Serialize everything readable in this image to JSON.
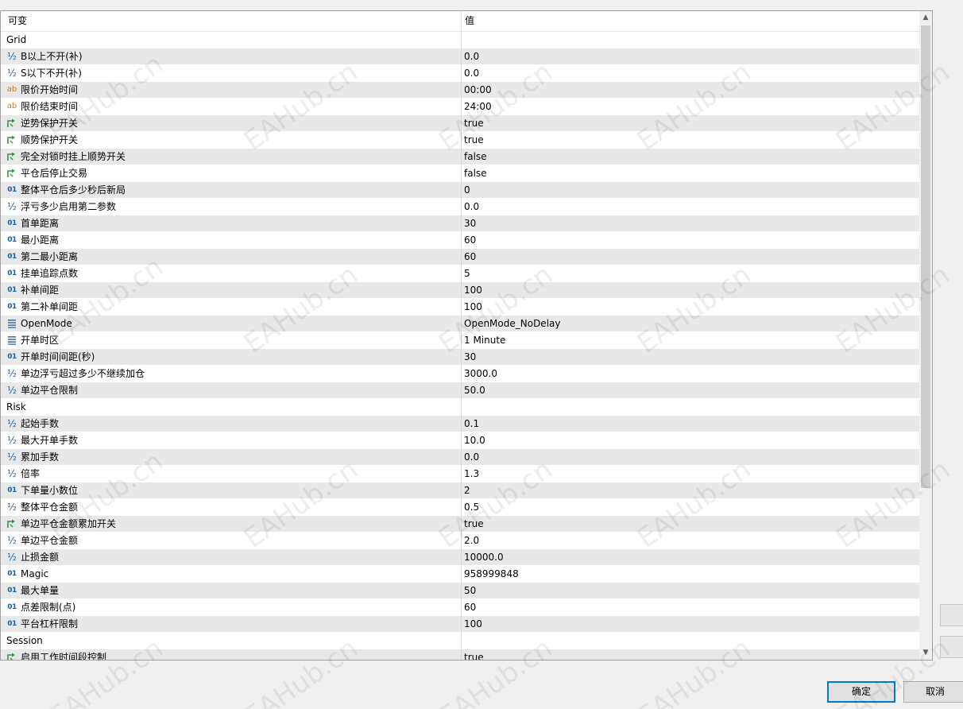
{
  "header": {
    "name_col": "可变",
    "value_col": "值"
  },
  "rows": [
    {
      "type": "group",
      "name": "Grid",
      "value": ""
    },
    {
      "type": "double",
      "name": "B以上不开(补)",
      "value": "0.0"
    },
    {
      "type": "double",
      "name": "S以下不开(补)",
      "value": "0.0"
    },
    {
      "type": "string",
      "name": "限价开始时间",
      "value": "00:00"
    },
    {
      "type": "string",
      "name": "限价结束时间",
      "value": "24:00"
    },
    {
      "type": "bool",
      "name": "逆势保护开关",
      "value": "true"
    },
    {
      "type": "bool",
      "name": "顺势保护开关",
      "value": "true"
    },
    {
      "type": "bool",
      "name": "完全对锁时挂上顺势开关",
      "value": "false"
    },
    {
      "type": "bool",
      "name": "平仓后停止交易",
      "value": "false"
    },
    {
      "type": "int",
      "name": "整体平仓后多少秒后新局",
      "value": "0"
    },
    {
      "type": "double",
      "name": "浮亏多少启用第二参数",
      "value": "0.0"
    },
    {
      "type": "int",
      "name": "首单距离",
      "value": "30"
    },
    {
      "type": "int",
      "name": "最小距离",
      "value": "60"
    },
    {
      "type": "int",
      "name": "第二最小距离",
      "value": "60"
    },
    {
      "type": "int",
      "name": "挂单追踪点数",
      "value": "5"
    },
    {
      "type": "int",
      "name": "补单间距",
      "value": "100"
    },
    {
      "type": "int",
      "name": "第二补单间距",
      "value": "100"
    },
    {
      "type": "enum",
      "name": "OpenMode",
      "value": "OpenMode_NoDelay"
    },
    {
      "type": "enum",
      "name": "开单时区",
      "value": "1 Minute"
    },
    {
      "type": "int",
      "name": "开单时间间距(秒)",
      "value": "30"
    },
    {
      "type": "double",
      "name": "单边浮亏超过多少不继续加仓",
      "value": "3000.0"
    },
    {
      "type": "double",
      "name": "单边平仓限制",
      "value": "50.0"
    },
    {
      "type": "group",
      "name": "Risk",
      "value": ""
    },
    {
      "type": "double",
      "name": "起始手数",
      "value": "0.1"
    },
    {
      "type": "double",
      "name": "最大开单手数",
      "value": "10.0"
    },
    {
      "type": "double",
      "name": "累加手数",
      "value": "0.0"
    },
    {
      "type": "double",
      "name": "倍率",
      "value": "1.3"
    },
    {
      "type": "int",
      "name": "下单量小数位",
      "value": "2"
    },
    {
      "type": "double",
      "name": "整体平仓金额",
      "value": "0.5"
    },
    {
      "type": "bool",
      "name": "单边平仓金额累加开关",
      "value": "true"
    },
    {
      "type": "double",
      "name": "单边平仓金额",
      "value": "2.0"
    },
    {
      "type": "double",
      "name": "止损金额",
      "value": "10000.0"
    },
    {
      "type": "int",
      "name": "Magic",
      "value": "958999848"
    },
    {
      "type": "int",
      "name": "最大单量",
      "value": "50"
    },
    {
      "type": "int",
      "name": "点差限制(点)",
      "value": "60"
    },
    {
      "type": "int",
      "name": "平台杠杆限制",
      "value": "100"
    },
    {
      "type": "group",
      "name": "Session",
      "value": ""
    },
    {
      "type": "bool",
      "name": "启用工作时间段控制",
      "value": "true"
    }
  ],
  "icons": {
    "double": "½",
    "string": "ab",
    "int": "01",
    "bool": "bool-arrow-icon",
    "enum": "enum-list-icon"
  },
  "icon_colors": {
    "double": "#1f5fa8",
    "string": "#c8791e",
    "int": "#1f5fa8",
    "bool": "#2e9a3a",
    "enum": "#4a6fa5"
  },
  "buttons": {
    "ok": "确定",
    "cancel": "取消"
  },
  "watermark": "EAHub.cn"
}
